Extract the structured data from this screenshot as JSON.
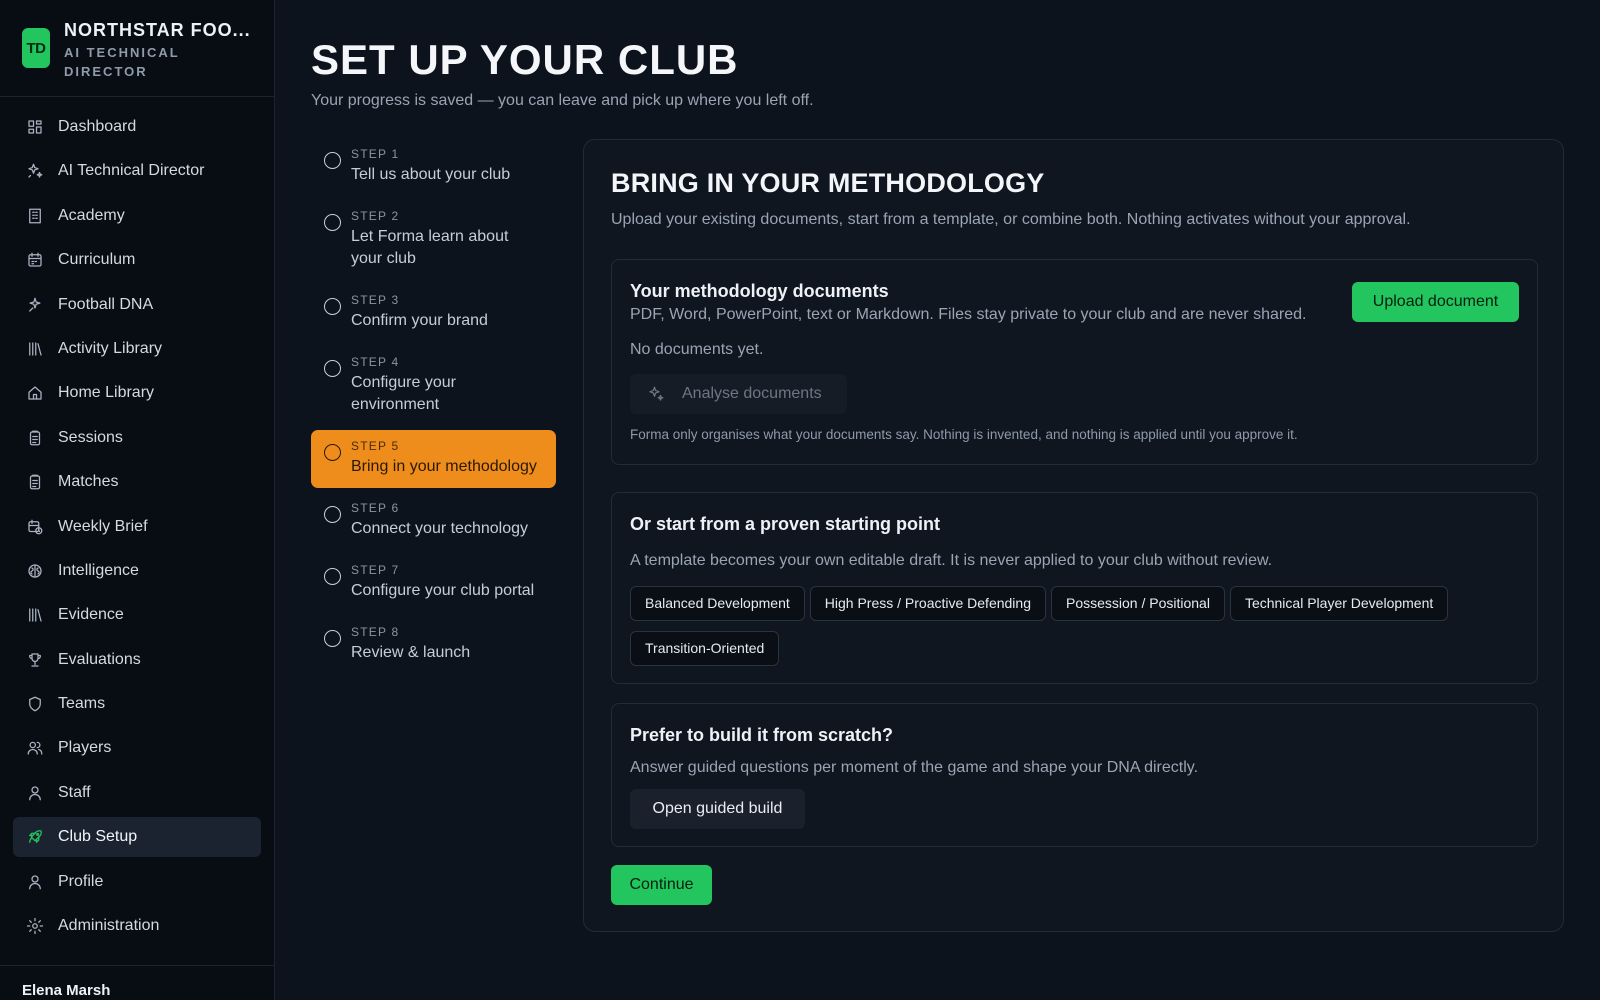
{
  "brand": {
    "logo": "TD",
    "name": "NORTHSTAR FOO...",
    "subtitle_line1": "AI TECHNICAL",
    "subtitle_line2": "DIRECTOR"
  },
  "sidebar": {
    "items": [
      {
        "label": "Dashboard",
        "icon": "dashboard-icon"
      },
      {
        "label": "AI Technical Director",
        "icon": "sparkles-icon"
      },
      {
        "label": "Academy",
        "icon": "building-icon"
      },
      {
        "label": "Curriculum",
        "icon": "calendar-icon"
      },
      {
        "label": "Football DNA",
        "icon": "sparkle-icon"
      },
      {
        "label": "Activity Library",
        "icon": "library-icon"
      },
      {
        "label": "Home Library",
        "icon": "home-icon"
      },
      {
        "label": "Sessions",
        "icon": "clipboard-icon"
      },
      {
        "label": "Matches",
        "icon": "clipboard-icon"
      },
      {
        "label": "Weekly Brief",
        "icon": "calendar-clock-icon"
      },
      {
        "label": "Intelligence",
        "icon": "brain-icon"
      },
      {
        "label": "Evidence",
        "icon": "library-icon"
      },
      {
        "label": "Evaluations",
        "icon": "trophy-icon"
      },
      {
        "label": "Teams",
        "icon": "shield-icon"
      },
      {
        "label": "Players",
        "icon": "users-icon"
      },
      {
        "label": "Staff",
        "icon": "user-icon"
      },
      {
        "label": "Club Setup",
        "icon": "rocket-icon",
        "active": true
      },
      {
        "label": "Profile",
        "icon": "user-icon"
      },
      {
        "label": "Administration",
        "icon": "gear-icon"
      }
    ],
    "user_name": "Elena Marsh"
  },
  "page": {
    "title": "SET UP YOUR CLUB",
    "subtitle": "Your progress is saved — you can leave and pick up where you left off."
  },
  "steps": [
    {
      "num": "STEP 1",
      "label": "Tell us about your club"
    },
    {
      "num": "STEP 2",
      "label": "Let Forma learn about your club"
    },
    {
      "num": "STEP 3",
      "label": "Confirm your brand"
    },
    {
      "num": "STEP 4",
      "label": "Configure your environment"
    },
    {
      "num": "STEP 5",
      "label": "Bring in your methodology",
      "active": true
    },
    {
      "num": "STEP 6",
      "label": "Connect your technology"
    },
    {
      "num": "STEP 7",
      "label": "Configure your club portal"
    },
    {
      "num": "STEP 8",
      "label": "Review & launch"
    }
  ],
  "card": {
    "title": "BRING IN YOUR METHODOLOGY",
    "subtitle": "Upload your existing documents, start from a template, or combine both. Nothing activates without your approval.",
    "documents": {
      "title": "Your methodology documents",
      "desc": "PDF, Word, PowerPoint, text or Markdown. Files stay private to your club and are never shared.",
      "upload_label": "Upload document",
      "empty": "No documents yet.",
      "analyse_label": "Analyse documents",
      "note": "Forma only organises what your documents say. Nothing is invented, and nothing is applied until you approve it."
    },
    "templates": {
      "title": "Or start from a proven starting point",
      "desc": "A template becomes your own editable draft. It is never applied to your club without review.",
      "options": [
        "Balanced Development",
        "High Press / Proactive Defending",
        "Possession / Positional",
        "Technical Player Development",
        "Transition-Oriented"
      ]
    },
    "scratch": {
      "title": "Prefer to build it from scratch?",
      "desc": "Answer guided questions per moment of the game and shape your DNA directly.",
      "button_label": "Open guided build"
    },
    "continue_label": "Continue"
  },
  "colors": {
    "accent_green": "#22c55e",
    "active_step": "#ee8c1c",
    "background": "#0d131c"
  }
}
